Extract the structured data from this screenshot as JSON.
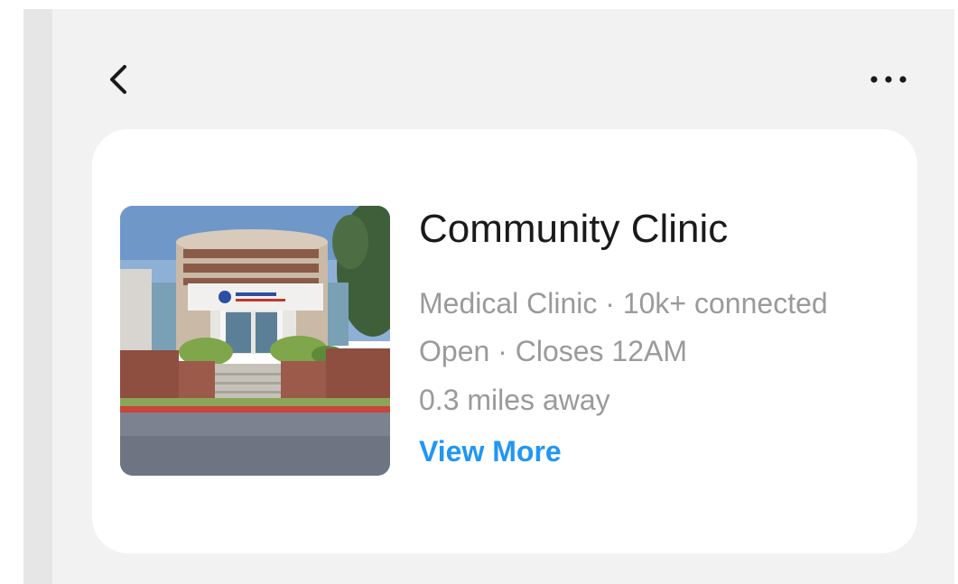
{
  "header": {
    "back_icon": "chevron-left-icon",
    "more_icon": "ellipsis-horizontal-icon"
  },
  "place": {
    "name": "Community Clinic",
    "category_line": "Medical Clinic · 10k+ connected",
    "hours_line": "Open · Closes 12AM",
    "distance_line": "0.3 miles away",
    "view_more_label": "View More",
    "photo_subject": "clinic-building-photo"
  },
  "colors": {
    "background": "#f2f2f2",
    "card": "#ffffff",
    "title": "#1a1a1a",
    "secondary_text": "#9a9a9a",
    "link": "#2196f3"
  }
}
